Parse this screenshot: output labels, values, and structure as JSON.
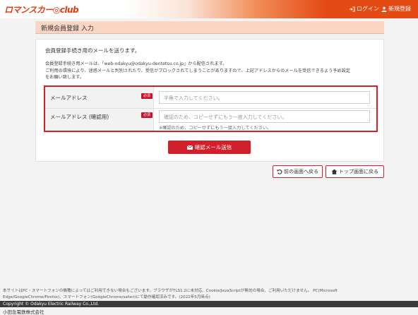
{
  "header": {
    "logo_text": "ロマンスカー◎club",
    "login_label": "ログイン",
    "register_label": "新規登録",
    "brand_color": "#e34a14"
  },
  "page_title": "新規会員登録 入力",
  "intro": "会員登録手続き用のメールを送ります。",
  "notes": [
    "会員登録手続き用メールは、「web-odakyu@odakyu-dentetsu.co.jp」から配信されます。",
    "ご利用の環境により、迷惑メールと判別されたり、受信がブロックされてしまうことがありますので、上記アドレスからのメールを受信できるよう予め設定",
    "をお願い致します。"
  ],
  "form": {
    "required_badge": "必須",
    "email_label": "メールアドレス",
    "email_placeholder": "半角で入力してください。",
    "confirm_label": "メールアドレス (確認用)",
    "confirm_placeholder": "確認のため、コピーせずにもう一度入力してください。",
    "confirm_hint": "※確認のため、コピーせずにもう一度入力してください。"
  },
  "buttons": {
    "send": "確認メール送信",
    "back": "前の画面へ戻る",
    "top": "トップ画面に戻る"
  },
  "footer": {
    "note_line1": "本サイトはPC・スマートフォンの機種によってはご利用できない場合もございます。ブラウザがTLS1.2に未対応、Cookie/JavaScriptが無効の場合、ご利用いただけません。 PC(Microsoft",
    "note_line2": "Edge/GoogleChrome/Firefox)、スマートフォン(GoogleChrome/safari)にて動作確認済みです。(2022年5月時点)",
    "copyright": "Copyright © Odakyu Electric Railway Co.,Ltd.",
    "company": "小田急電鉄株式会社"
  },
  "icons": {
    "login": "sign-in-icon",
    "register": "user-icon",
    "send": "envelope-icon",
    "back": "undo-icon",
    "top": "home-icon"
  }
}
